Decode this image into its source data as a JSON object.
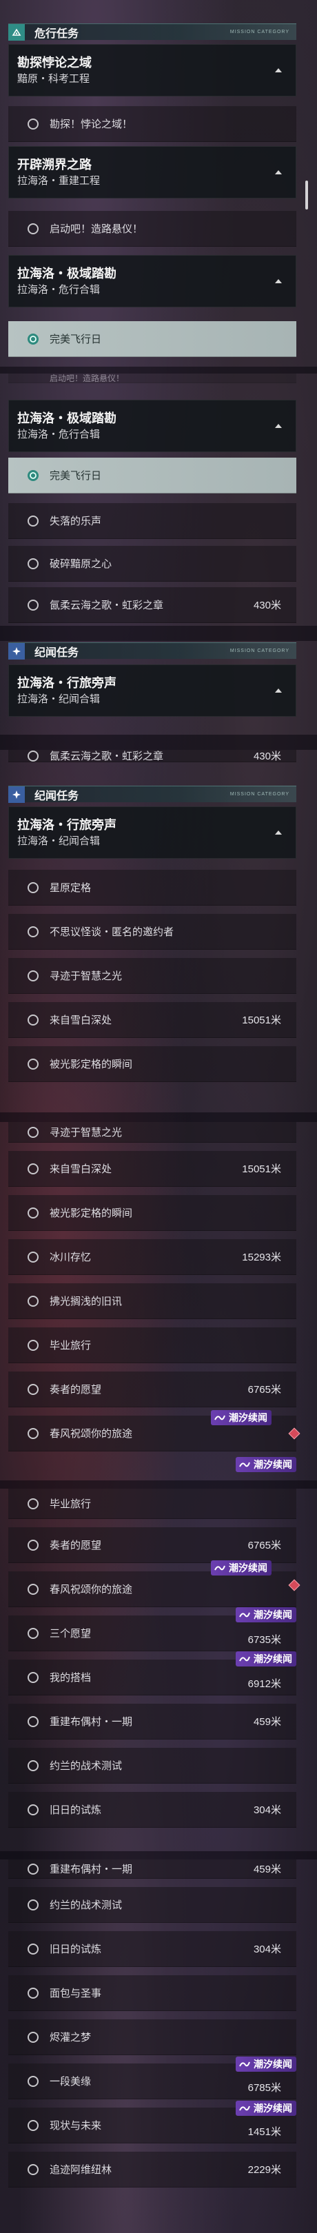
{
  "categories": {
    "urgent": "危行任务",
    "legend": "纪闻任务",
    "tag": "MISSION CATEGORY"
  },
  "quests": {
    "q1": {
      "title": "勘探悖论之域",
      "sub": "黯原・科考工程"
    },
    "q2": {
      "title": "开辟溯界之路",
      "sub": "拉海洛・重建工程"
    },
    "q3": {
      "title": "拉海洛・极域踏勘",
      "sub": "拉海洛・危行合辑"
    },
    "q4": {
      "title": "拉海洛・行旅旁声",
      "sub": "拉海洛・纪闻合辑"
    }
  },
  "items": {
    "i1": "勘探！悖论之域！",
    "i2": "启动吧！造路悬仪！",
    "i3": "完美飞行日",
    "i4": "失落的乐声",
    "i5": "破碎黯原之心",
    "i6": "氤柔云海之歌・虹彩之章",
    "i7": "星原定格",
    "i8": "不思议怪谈・匿名的邀约者",
    "i9": "寻迹于智慧之光",
    "i10": "来自雪白深处",
    "i11": "被光影定格的瞬间",
    "i12": "冰川存忆",
    "i13": "拂光搁浅的旧讯",
    "i14": "毕业旅行",
    "i15": "奏者的愿望",
    "i16": "春风祝颂你的旅途",
    "i17": "三个愿望",
    "i18": "我的搭档",
    "i19": "重建布偶村・一期",
    "i20": "约兰的战术测试",
    "i21": "旧日的试炼",
    "i22": "面包与圣事",
    "i23": "烬灌之梦",
    "i24": "一段美缘",
    "i25": "现状与未来",
    "i26": "追迹阿维纽林",
    "i27": "启动吧！造路悬仪！"
  },
  "distances": {
    "d430": "430米",
    "d15051": "15051米",
    "d15293": "15293米",
    "d6765": "6765米",
    "d6735": "6735米",
    "d6912": "6912米",
    "d459": "459米",
    "d304": "304米",
    "d6785": "6785米",
    "d1451": "1451米",
    "d2229": "2229米"
  },
  "badge": "潮汐续闻",
  "colors": {
    "accent": "#2f8d86",
    "badge": "#6b3fb0",
    "alert": "#d64a5a"
  }
}
